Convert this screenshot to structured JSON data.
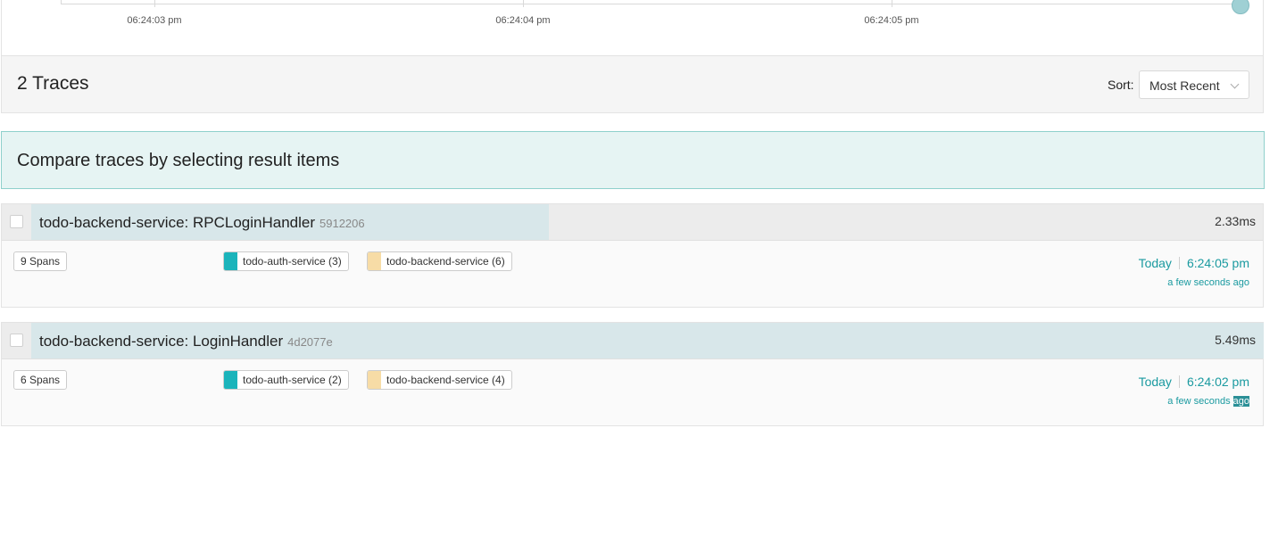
{
  "timeline": {
    "ticks": [
      {
        "label": "06:24:03 pm"
      },
      {
        "label": "06:24:04 pm"
      },
      {
        "label": "06:24:05 pm"
      }
    ]
  },
  "results": {
    "count_label": "2 Traces",
    "sort_label": "Sort:",
    "sort_value": "Most Recent"
  },
  "compare": {
    "text": "Compare traces by selecting result items"
  },
  "colors": {
    "accent": "#1a9aa0",
    "auth_service": "#1bb4bb",
    "backend_service": "#f7dca6",
    "compare_bg": "#e6f4f3"
  },
  "traces": [
    {
      "name": "todo-backend-service: RPCLoginHandler",
      "id": "5912206",
      "duration": "2.33ms",
      "duration_fraction": 0.42,
      "spans": "9 Spans",
      "services": [
        {
          "label": "todo-auth-service (3)",
          "color": "#1bb4bb"
        },
        {
          "label": "todo-backend-service (6)",
          "color": "#f7dca6"
        }
      ],
      "day": "Today",
      "time": "6:24:05 pm",
      "ago": "a few seconds ago"
    },
    {
      "name": "todo-backend-service: LoginHandler",
      "id": "4d2077e",
      "duration": "5.49ms",
      "duration_fraction": 1.0,
      "spans": "6 Spans",
      "services": [
        {
          "label": "todo-auth-service (2)",
          "color": "#1bb4bb"
        },
        {
          "label": "todo-backend-service (4)",
          "color": "#f7dca6"
        }
      ],
      "day": "Today",
      "time": "6:24:02 pm",
      "ago_prefix": "a few seconds ",
      "ago_selected": "ago"
    }
  ]
}
